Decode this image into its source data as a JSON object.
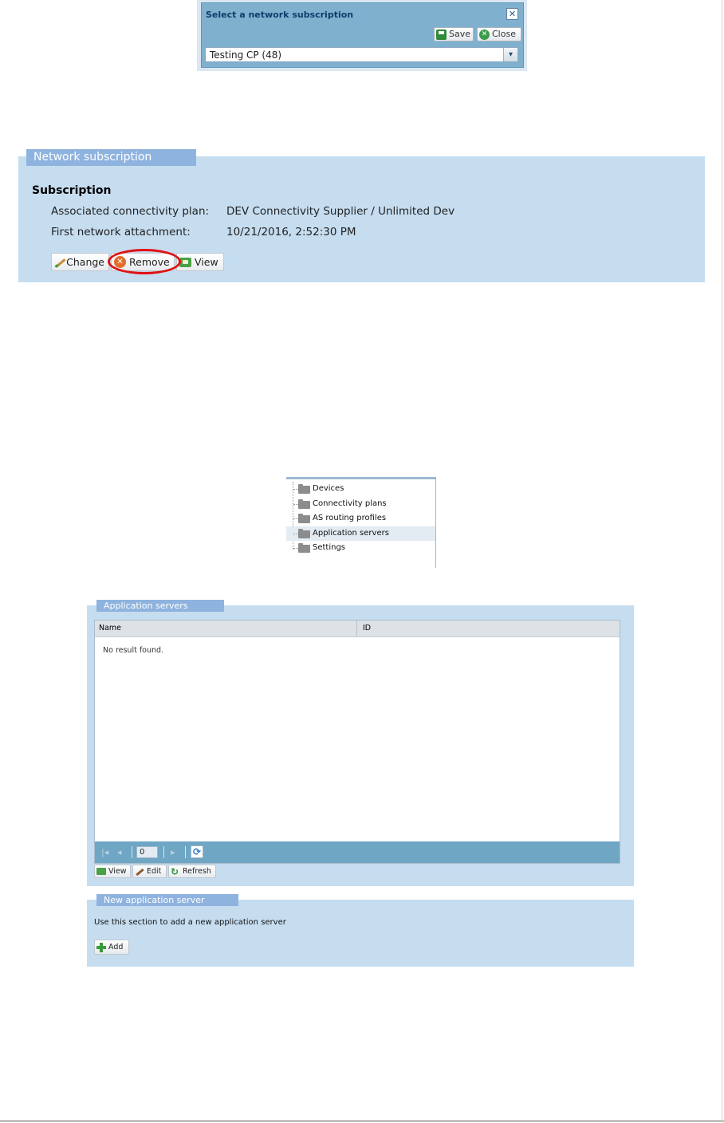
{
  "dialog": {
    "title": "Select a network subscription",
    "save_label": "Save",
    "close_label": "Close",
    "close_x": "✕",
    "selected_value": "Testing CP (48)",
    "dropdown_arrow": "▾"
  },
  "network_subscription": {
    "legend": "Network subscription",
    "section_title": "Subscription",
    "plan_label": "Associated connectivity plan:",
    "plan_value": "DEV Connectivity Supplier / Unlimited Dev",
    "attach_label": "First network attachment:",
    "attach_value": "10/21/2016, 2:52:30 PM",
    "buttons": {
      "change": "Change",
      "remove": "Remove",
      "view": "View"
    },
    "highlight_color": "#e01212"
  },
  "tree": {
    "items": [
      {
        "label": "Devices",
        "selected": false
      },
      {
        "label": "Connectivity plans",
        "selected": false
      },
      {
        "label": "AS routing profiles",
        "selected": false
      },
      {
        "label": "Application servers",
        "selected": true
      },
      {
        "label": "Settings",
        "selected": false
      }
    ]
  },
  "application_servers": {
    "legend": "Application servers",
    "columns": [
      "Name",
      "ID"
    ],
    "empty_text": "No result found.",
    "pager": {
      "page_value": "0"
    },
    "buttons": {
      "view": "View",
      "edit": "Edit",
      "refresh": "Refresh"
    }
  },
  "new_application_server": {
    "legend": "New application server",
    "description": "Use this section to add a new application server",
    "add_label": "Add"
  },
  "colors": {
    "panel_bg": "#c6ddf0",
    "legend_bg": "#8fb3df",
    "pager_bg": "#6ea6c4",
    "dialog_bg": "#7fb1cf"
  },
  "icons": {
    "save": "save-icon",
    "close": "close-circle-icon",
    "change": "pencil-icon",
    "remove": "remove-circle-icon",
    "view": "view-icon",
    "folder": "folder-icon",
    "refresh": "refresh-icon",
    "add": "plus-icon"
  }
}
